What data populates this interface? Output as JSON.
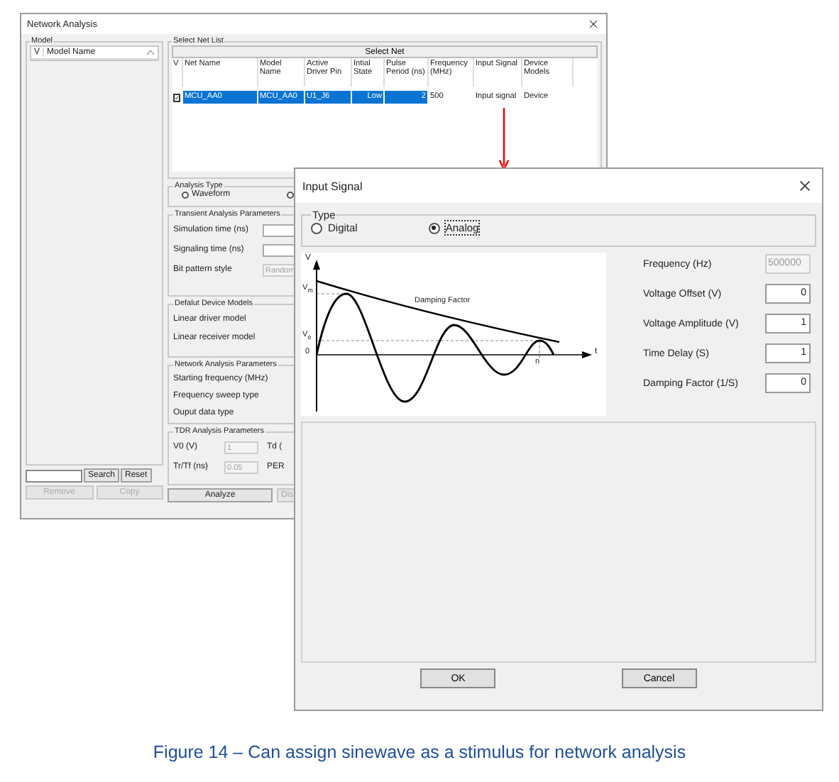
{
  "network_window": {
    "title": "Network Analysis",
    "model_group": {
      "legend": "Model",
      "columns": [
        "V",
        "Model Name"
      ]
    },
    "search_buttons": [
      {
        "label": "Search",
        "disabled": false
      },
      {
        "label": "Reset",
        "disabled": false
      }
    ],
    "list_buttons": [
      {
        "label": "Remove",
        "disabled": true
      },
      {
        "label": "Copy",
        "disabled": true
      }
    ],
    "net_list": {
      "legend": "Select Net List",
      "header_button": "Select Net",
      "check_column_header": "V",
      "columns": [
        "Net Name",
        "Model Name",
        "Active Driver Pin",
        "Intial State",
        "Pulse Period (ns)",
        "Frequency (MHz)",
        "Input Signal",
        "Device Models"
      ],
      "rows": [
        {
          "checked": true,
          "selected": true,
          "cells": [
            "MCU_AA0",
            "MCU_AA0",
            "U1_J6",
            "Low",
            "2",
            "500",
            "Input signal",
            "Device"
          ]
        }
      ]
    },
    "analysis_type": {
      "legend": "Analysis Type",
      "options": [
        {
          "label": "Waveform",
          "selected": false
        },
        {
          "selected": false
        }
      ]
    },
    "transient": {
      "legend": "Transient Analysis Parameters",
      "fields": [
        {
          "label": "Simulation time (ns)",
          "disabled": false
        },
        {
          "label": "Signaling time (ns)",
          "disabled": false
        },
        {
          "label": "Bit pattern style",
          "value": "Random",
          "disabled": true
        }
      ]
    },
    "default_models": {
      "legend": "Defalut Device Models",
      "labels": [
        "Linear driver model",
        "Linear receiver model"
      ]
    },
    "network_params": {
      "legend": "Network Analysis Parameters",
      "labels": [
        "Starting frequency (MHz)",
        "Frequency sweep type",
        "Ouput data type"
      ]
    },
    "tdr": {
      "legend": "TDR Analysis Parameters",
      "fields": [
        {
          "label": "V0 (V)",
          "value": "1",
          "side_label": "Td ("
        },
        {
          "label": "Tr/Tf (ns)",
          "value": "0.05",
          "side_label": "PER"
        }
      ]
    },
    "buttons": [
      {
        "label": "Analyze",
        "disabled": false
      },
      {
        "label": "Dis",
        "disabled": true
      }
    ]
  },
  "input_signal_dialog": {
    "title": "Input Signal",
    "type_group": {
      "legend": "Type",
      "options": [
        {
          "label": "Digital",
          "selected": false
        },
        {
          "label": "Analog",
          "selected": true
        }
      ]
    },
    "graph_labels": {
      "y_axis": "V",
      "x_axis": "t",
      "vm": "V$_{m}$",
      "vo": "V$_{o}$",
      "zero": "0",
      "n": "n",
      "envelope": "Damping Factor"
    },
    "params": [
      {
        "label": "Frequency (Hz)",
        "value": "500000",
        "disabled": true
      },
      {
        "label": "Voltage Offset (V)",
        "value": "0",
        "disabled": false
      },
      {
        "label": "Voltage Amplitude (V)",
        "value": "1",
        "disabled": false
      },
      {
        "label": "Time Delay (S)",
        "value": "1",
        "disabled": false
      },
      {
        "label": "Damping Factor (1/S)",
        "value": "0",
        "disabled": false
      }
    ],
    "buttons": [
      "OK",
      "Cancel"
    ]
  },
  "caption": "Figure 14 – Can assign sinewave as a stimulus for network analysis"
}
